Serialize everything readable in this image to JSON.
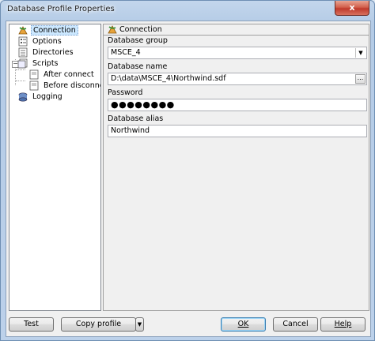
{
  "window": {
    "title": "Database Profile Properties",
    "close_glyph": "x"
  },
  "tree": {
    "items": [
      {
        "label": "Connection",
        "icon": "connection-icon",
        "selected": true
      },
      {
        "label": "Options",
        "icon": "options-icon"
      },
      {
        "label": "Directories",
        "icon": "directories-icon"
      },
      {
        "label": "Scripts",
        "icon": "scripts-icon",
        "expanded": true
      },
      {
        "label": "After connect",
        "icon": "script-file-icon"
      },
      {
        "label": "Before disconnect",
        "icon": "script-file-icon"
      },
      {
        "label": "Logging",
        "icon": "logging-icon"
      }
    ],
    "expander_glyph": "−"
  },
  "panel": {
    "header": "Connection",
    "database_group": {
      "label": "Database group",
      "value": "MSCE_4",
      "arrow": "▼"
    },
    "database_name": {
      "label": "Database name",
      "value": "D:\\data\\MSCE_4\\Northwind.sdf",
      "browse": "..."
    },
    "password": {
      "label": "Password",
      "value": "●●●●●●●●"
    },
    "database_alias": {
      "label": "Database alias",
      "value": "Northwind"
    }
  },
  "buttons": {
    "test": "Test",
    "copy_profile": "Copy profile",
    "copy_profile_arrow": "▼",
    "ok": "OK",
    "cancel": "Cancel",
    "help": "Help"
  },
  "colors": {
    "selection": "#cce8ff",
    "close": "#c0392b",
    "frame": "#b4cbe6"
  }
}
